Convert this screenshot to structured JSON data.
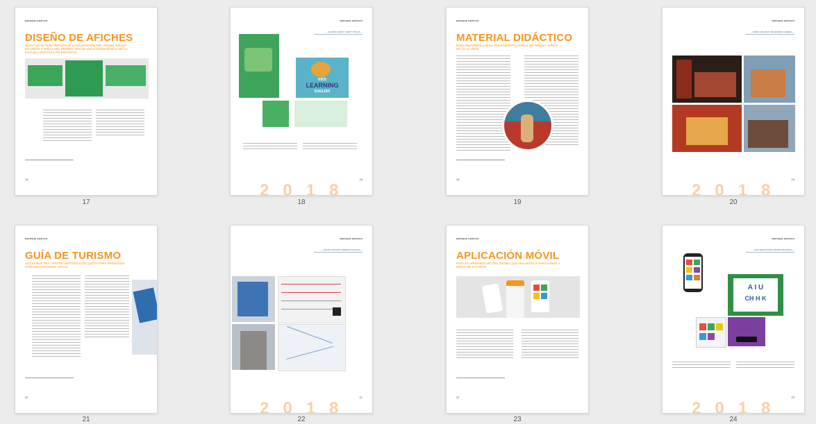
{
  "brand": "ENFOQUE GRÁFICO",
  "year_deco": "2018",
  "pages": [
    {
      "label": "17",
      "title": "DISEÑO DE AFICHES",
      "subtitle": "DIDÁCTICOS PARA REFORZAR LA EDUCACIÓN DEL IDIOMA INGLÉS EN NIÑOS Y NIÑAS DEL PRIMER AÑO DE EDUCACIÓN BÁSICA DE LA ESCUELA PARTICULAR EXPOSITO",
      "num": "14"
    },
    {
      "label": "18",
      "author": "— FLORES GODOY JHENY STALIN —",
      "num": "15",
      "book_title": "LEARNING",
      "book_kids": "KIDS",
      "book_english": "ENGLISH"
    },
    {
      "label": "19",
      "title": "MATERIAL DIDÁCTICO",
      "subtitle": "PARA DESARROLLAR EL PENSAMIENTO VISUAL EN NIÑOS Y NIÑAS DE 10-11 AÑOS",
      "num": "16"
    },
    {
      "label": "20",
      "author": "— PABLO RICARDO BENAVIDES GUERRA —",
      "num": "19"
    },
    {
      "label": "21",
      "title": "GUÍA DE TURISMO",
      "subtitle": "ACCESIBLE DEL CENTRO HISTÓRICO DE QUITO PARA PERSONAS CON DISCAPACIDAD VISUAL",
      "num": "20"
    },
    {
      "label": "22",
      "author": "— ISRAEL ANTONIO LEDESMA NATUTE —",
      "num": "21"
    },
    {
      "label": "23",
      "title": "APLICACIÓN MÓVIL",
      "subtitle": "PARA EL APRENDIZAJE DEL IDIOMA QUICHUA BÁSICO PARA NIÑOS Y NIÑAS DE 5-6 AÑOS",
      "num": "22"
    },
    {
      "label": "24",
      "author": "— ESCOBAR RUANO DARWIN RICARDO —",
      "num": "23",
      "app_letters_top": "A I U",
      "app_letters_bottom": "CH H K"
    }
  ],
  "colors": {
    "accent": "#f7941d",
    "page_bg": "#ffffff",
    "canvas_bg": "#ececec"
  }
}
